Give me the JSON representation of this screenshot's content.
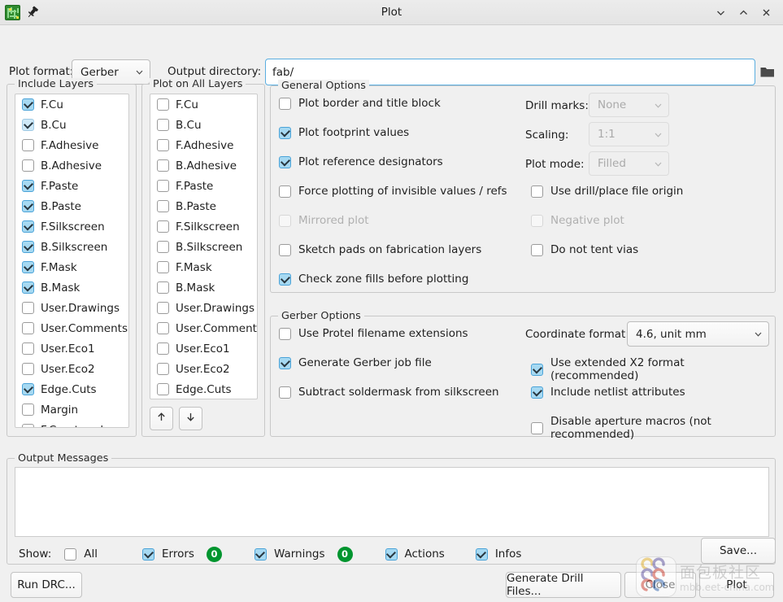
{
  "window": {
    "title": "Plot",
    "app_icon": "pcb-icon",
    "pin_icon": "pin-icon",
    "minimize_icon": "chevron-down-icon",
    "maximize_icon": "chevron-up-icon",
    "close_icon": "close-icon"
  },
  "toolbar": {
    "plot_format_label": "Plot format:",
    "plot_format_value": "Gerber",
    "output_dir_label": "Output directory:",
    "output_dir_value": "fab/",
    "output_dir_placeholder": "",
    "browse_icon": "folder-icon"
  },
  "include_layers": {
    "title": "Include Layers",
    "items": [
      {
        "label": "F.Cu",
        "checked": true,
        "soft": false
      },
      {
        "label": "B.Cu",
        "checked": true,
        "soft": true
      },
      {
        "label": "F.Adhesive",
        "checked": false,
        "soft": false
      },
      {
        "label": "B.Adhesive",
        "checked": false,
        "soft": false
      },
      {
        "label": "F.Paste",
        "checked": true,
        "soft": false
      },
      {
        "label": "B.Paste",
        "checked": true,
        "soft": false
      },
      {
        "label": "F.Silkscreen",
        "checked": true,
        "soft": false
      },
      {
        "label": "B.Silkscreen",
        "checked": true,
        "soft": false
      },
      {
        "label": "F.Mask",
        "checked": true,
        "soft": false
      },
      {
        "label": "B.Mask",
        "checked": true,
        "soft": false
      },
      {
        "label": "User.Drawings",
        "checked": false,
        "soft": false
      },
      {
        "label": "User.Comments",
        "checked": false,
        "soft": false
      },
      {
        "label": "User.Eco1",
        "checked": false,
        "soft": false
      },
      {
        "label": "User.Eco2",
        "checked": false,
        "soft": false
      },
      {
        "label": "Edge.Cuts",
        "checked": true,
        "soft": false
      },
      {
        "label": "Margin",
        "checked": false,
        "soft": false
      },
      {
        "label": "F.Courtyard",
        "checked": false,
        "soft": false
      }
    ]
  },
  "plot_on_all_layers": {
    "title": "Plot on All Layers",
    "move_up_icon": "arrow-up-icon",
    "move_down_icon": "arrow-down-icon",
    "items": [
      {
        "label": "F.Cu",
        "checked": false
      },
      {
        "label": "B.Cu",
        "checked": false
      },
      {
        "label": "F.Adhesive",
        "checked": false
      },
      {
        "label": "B.Adhesive",
        "checked": false
      },
      {
        "label": "F.Paste",
        "checked": false
      },
      {
        "label": "B.Paste",
        "checked": false
      },
      {
        "label": "F.Silkscreen",
        "checked": false
      },
      {
        "label": "B.Silkscreen",
        "checked": false
      },
      {
        "label": "F.Mask",
        "checked": false
      },
      {
        "label": "B.Mask",
        "checked": false
      },
      {
        "label": "User.Drawings",
        "checked": false
      },
      {
        "label": "User.Comments",
        "checked": false
      },
      {
        "label": "User.Eco1",
        "checked": false
      },
      {
        "label": "User.Eco2",
        "checked": false
      },
      {
        "label": "Edge.Cuts",
        "checked": false
      }
    ]
  },
  "general_options": {
    "title": "General Options",
    "left": [
      {
        "label": "Plot border and title block",
        "checked": false,
        "enabled": true
      },
      {
        "label": "Plot footprint values",
        "checked": true,
        "enabled": true
      },
      {
        "label": "Plot reference designators",
        "checked": true,
        "enabled": true
      },
      {
        "label": "Force plotting of invisible values / refs",
        "checked": false,
        "enabled": true
      },
      {
        "label": "Mirrored plot",
        "checked": false,
        "enabled": false
      },
      {
        "label": "Sketch pads on fabrication layers",
        "checked": false,
        "enabled": true
      },
      {
        "label": "Check zone fills before plotting",
        "checked": true,
        "enabled": true
      }
    ],
    "drill_marks_label": "Drill marks:",
    "drill_marks_value": "None",
    "drill_marks_enabled": false,
    "scaling_label": "Scaling:",
    "scaling_value": "1:1",
    "scaling_enabled": false,
    "plot_mode_label": "Plot mode:",
    "plot_mode_value": "Filled",
    "plot_mode_enabled": false,
    "right": [
      {
        "label": "Use drill/place file origin",
        "checked": false,
        "enabled": true
      },
      {
        "label": "Negative plot",
        "checked": false,
        "enabled": false
      },
      {
        "label": "Do not tent vias",
        "checked": false,
        "enabled": true
      }
    ]
  },
  "gerber_options": {
    "title": "Gerber Options",
    "left": [
      {
        "label": "Use Protel filename extensions",
        "checked": false
      },
      {
        "label": "Generate Gerber job file",
        "checked": true
      },
      {
        "label": "Subtract soldermask from silkscreen",
        "checked": false
      }
    ],
    "coordinate_format_label": "Coordinate format:",
    "coordinate_format_value": "4.6, unit mm",
    "right": [
      {
        "label": "Use extended X2 format (recommended)",
        "checked": true
      },
      {
        "label": "Include netlist attributes",
        "checked": true
      },
      {
        "label": "Disable aperture macros (not recommended)",
        "checked": false
      }
    ]
  },
  "output_messages": {
    "title": "Output Messages",
    "body": "",
    "show_label": "Show:",
    "filters": [
      {
        "label": "All",
        "checked": false,
        "badge": null
      },
      {
        "label": "Errors",
        "checked": true,
        "badge": "0"
      },
      {
        "label": "Warnings",
        "checked": true,
        "badge": "0"
      },
      {
        "label": "Actions",
        "checked": true,
        "badge": null
      },
      {
        "label": "Infos",
        "checked": true,
        "badge": null
      }
    ]
  },
  "buttons": {
    "save": "Save...",
    "run_drc": "Run DRC...",
    "generate_drill": "Generate Drill Files...",
    "close": "Close",
    "plot": "Plot"
  },
  "watermark": {
    "text_cn": "面包板社区",
    "text_url": "mbb.eet-china.com"
  },
  "colors": {
    "accent_checkbox": "#a6d9f2",
    "accent_border": "#4ba3d8",
    "focus_border": "#5aaee0",
    "badge_green": "#00952f",
    "window_bg": "#f0f0f0"
  }
}
